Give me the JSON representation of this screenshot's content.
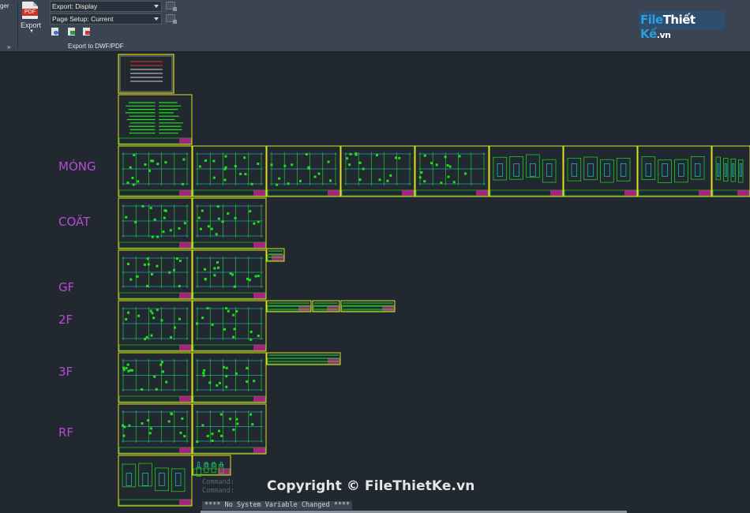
{
  "ribbon": {
    "edge_label": "ger",
    "export_button": {
      "icon": "pdf-icon",
      "icon_text": "PDF",
      "label": "Export"
    },
    "export_dropdown": {
      "value": "Export: Display"
    },
    "page_setup_dropdown": {
      "value": "Page Setup: Current"
    },
    "panel_label": "Export to DWF/PDF",
    "collapse_glyph": "»"
  },
  "logo": {
    "part1": "File",
    "part2": "Thiết",
    "part3": "Kế",
    "part4": ".vn"
  },
  "floor_labels": [
    "MÓNG",
    "COÄT",
    "GF",
    "2F",
    "3F",
    "RF"
  ],
  "command_line": {
    "history": [
      "Command:",
      "Command:"
    ],
    "status": "**** No System Variable Changed ****"
  },
  "watermark": "Copyright © FileThietKe.vn",
  "colors": {
    "canvas_bg": "#212830",
    "ribbon_bg": "#3b4453",
    "sheet_border": "#e0e020",
    "line_green": "#20e020",
    "line_cyan": "#20e0e0",
    "line_magenta": "#e020a0",
    "label_purple": "#b94ad8"
  }
}
